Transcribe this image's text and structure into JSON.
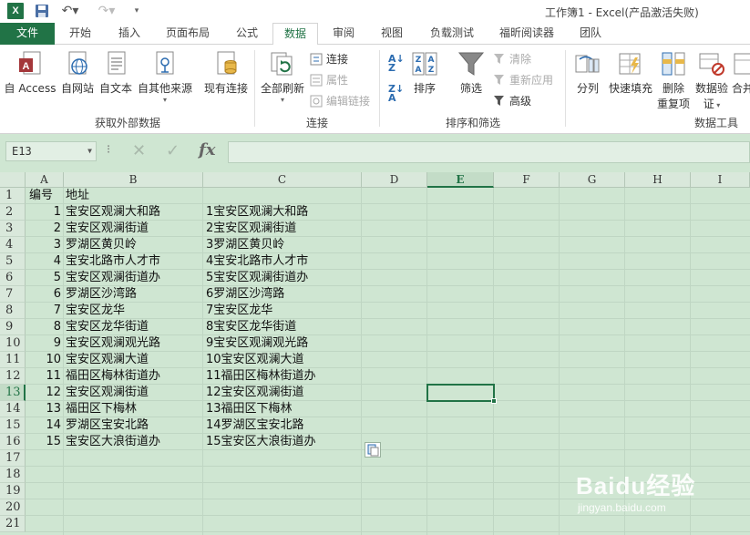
{
  "window": {
    "title": "工作簿1 - Excel(产品激活失败)",
    "app_logo": "X",
    "colors": {
      "excel_green": "#217346",
      "sheet_bg": "#cfe6d2"
    }
  },
  "tabs": [
    {
      "label": "文件"
    },
    {
      "label": "开始"
    },
    {
      "label": "插入"
    },
    {
      "label": "页面布局"
    },
    {
      "label": "公式"
    },
    {
      "label": "数据"
    },
    {
      "label": "审阅"
    },
    {
      "label": "视图"
    },
    {
      "label": "负载测试"
    },
    {
      "label": "福昕阅读器"
    },
    {
      "label": "团队"
    }
  ],
  "ribbon": {
    "external": {
      "access": "自 Access",
      "web": "自网站",
      "text": "自文本",
      "other": "自其他来源",
      "group": "获取外部数据"
    },
    "existing": "现有连接",
    "connections": {
      "refresh_all": "全部刷新",
      "connections": "连接",
      "properties": "属性",
      "edit_links": "编辑链接",
      "group": "连接"
    },
    "sort_filter": {
      "sort": "排序",
      "filter": "筛选",
      "clear": "清除",
      "reapply": "重新应用",
      "advanced": "高级",
      "group": "排序和筛选"
    },
    "data_tools": {
      "split": "分列",
      "flash_fill": "快速填充",
      "remove_dup_1": "删除",
      "remove_dup_2": "重复项",
      "validate_1": "数据验",
      "validate_2": "证",
      "consolidate": "合并",
      "group": "数据工具"
    }
  },
  "formula_bar": {
    "name_box": "E13",
    "fx": "fx",
    "formula": ""
  },
  "columns": [
    "A",
    "B",
    "C",
    "D",
    "E",
    "F",
    "G",
    "H",
    "I"
  ],
  "rows": [
    "1",
    "2",
    "3",
    "4",
    "5",
    "6",
    "7",
    "8",
    "9",
    "10",
    "11",
    "12",
    "13",
    "14",
    "15",
    "16",
    "17",
    "18",
    "19",
    "20",
    "21"
  ],
  "selected": {
    "cell": "E13",
    "row": "13",
    "col": "E"
  },
  "sheet": {
    "header": {
      "a": "编号",
      "b": "地址"
    },
    "data": [
      {
        "a": "1",
        "b": "宝安区观澜大和路",
        "c": "1宝安区观澜大和路"
      },
      {
        "a": "2",
        "b": "宝安区观澜街道",
        "c": "2宝安区观澜街道"
      },
      {
        "a": "3",
        "b": "罗湖区黄贝岭",
        "c": "3罗湖区黄贝岭"
      },
      {
        "a": "4",
        "b": "宝安北路市人才市",
        "c": "4宝安北路市人才市"
      },
      {
        "a": "5",
        "b": "宝安区观澜街道办",
        "c": "5宝安区观澜街道办"
      },
      {
        "a": "6",
        "b": "罗湖区沙湾路",
        "c": "6罗湖区沙湾路"
      },
      {
        "a": "7",
        "b": "宝安区龙华",
        "c": "7宝安区龙华"
      },
      {
        "a": "8",
        "b": "宝安区龙华街道",
        "c": "8宝安区龙华街道"
      },
      {
        "a": "9",
        "b": "宝安区观澜观光路",
        "c": "9宝安区观澜观光路"
      },
      {
        "a": "10",
        "b": "宝安区观澜大道",
        "c": "10宝安区观澜大道"
      },
      {
        "a": "11",
        "b": "福田区梅林街道办",
        "c": "11福田区梅林街道办"
      },
      {
        "a": "12",
        "b": "宝安区观澜街道",
        "c": "12宝安区观澜街道"
      },
      {
        "a": "13",
        "b": "福田区下梅林",
        "c": "13福田区下梅林"
      },
      {
        "a": "14",
        "b": "罗湖区宝安北路",
        "c": "14罗湖区宝安北路"
      },
      {
        "a": "15",
        "b": "宝安区大浪街道办",
        "c": "15宝安区大浪街道办"
      }
    ]
  },
  "watermark": {
    "brand": "Baidu经验",
    "url": "jingyan.baidu.com"
  }
}
